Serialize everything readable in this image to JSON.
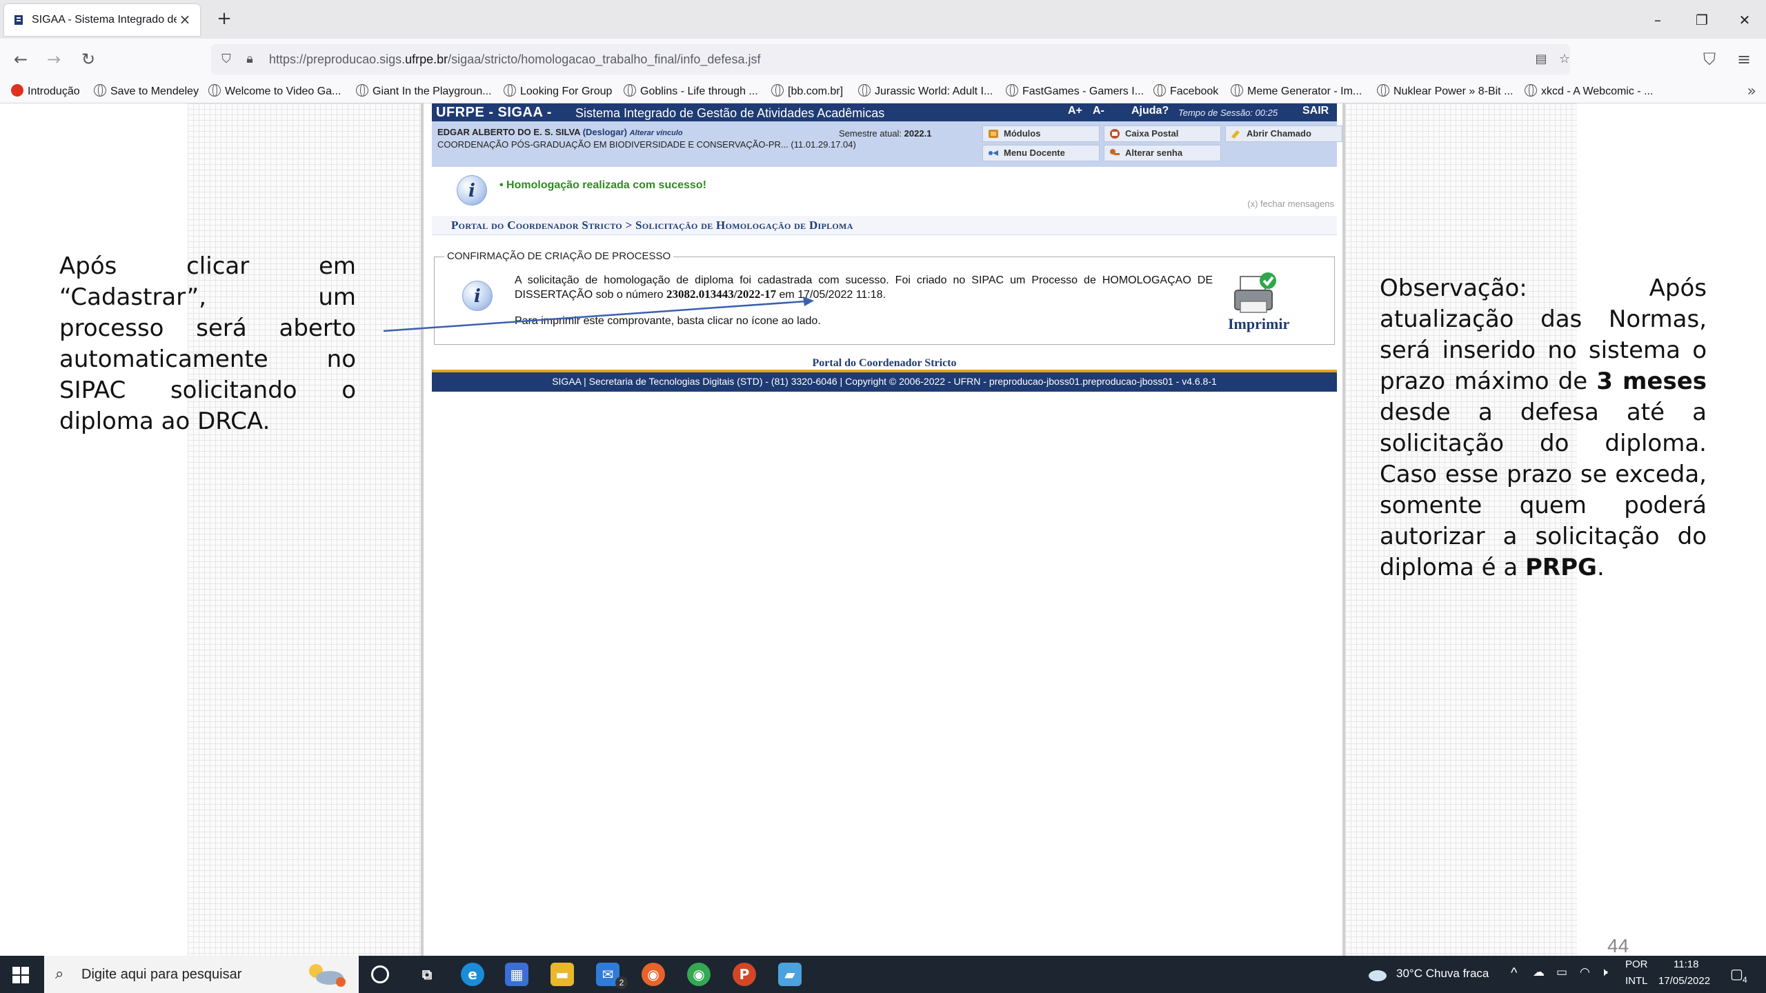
{
  "browser": {
    "tab_title": "SIGAA - Sistema Integrado de G",
    "url_prefix": "https://preproducao.sigs.",
    "url_domain": "ufrpe.br",
    "url_path": "/sigaa/stricto/homologacao_trabalho_final/info_defesa.jsf",
    "bookmarks": [
      "Introdução",
      "Save to Mendeley",
      "Welcome to Video Ga...",
      "Giant In the Playgroun...",
      "Looking For Group",
      "Goblins - Life through ...",
      "[bb.com.br]",
      "Jurassic World: Adult I...",
      "FastGames - Gamers I...",
      "Facebook",
      "Meme Generator - Im...",
      "Nuklear Power » 8-Bit ...",
      "xkcd - A Webcomic - ..."
    ]
  },
  "slide": {
    "left_note": "Após clicar em “Cadastrar”, um processo será aberto automaticamente no SIPAC solicitando o diploma ao DRCA.",
    "right_note_part1": "Observação: Após atualização das Normas, será inserido no sistema o prazo máximo de ",
    "right_note_bold1": "3 meses",
    "right_note_part2": " desde a defesa até a solicitação do diploma. Caso esse prazo se exceda, somente quem poderá autorizar a solicitação do diploma é a ",
    "right_note_bold2": "PRPG",
    "right_note_part3": ".",
    "page_number": "44"
  },
  "sigaa": {
    "brand": "UFRPE - SIGAA -",
    "system_name": "Sistema Integrado de Gestão de Atividades Acadêmicas",
    "font_up": "A+",
    "font_down": "A-",
    "help": "Ajuda?",
    "session_label": "Tempo de Sessão: 00:25",
    "logout": "SAIR",
    "user_name": "EDGAR ALBERTO DO E. S. SILVA",
    "logoff_link": "(Deslogar)",
    "change_link": "Alterar vínculo",
    "coordination": "COORDENAÇÃO PÓS-GRADUAÇÃO EM BIODIVERSIDADE E CONSERVAÇÃO-PR... (11.01.29.17.04)",
    "semester_label": "Semestre atual:",
    "semester_value": "2022.1",
    "menu": {
      "modules": "Módulos",
      "mailbox": "Caixa Postal",
      "ticket": "Abrir Chamado",
      "teacher_menu": "Menu Docente",
      "change_password": "Alterar senha"
    },
    "success_message": "• Homologação realizada com sucesso!",
    "close_messages": "(x) fechar mensagens",
    "breadcrumb": "Portal do Coordenador Stricto > Solicitação de Homologação de Diploma",
    "box_title": "CONFIRMAÇÃO DE CRIAÇÃO DE PROCESSO",
    "box_text_1": "A solicitação de homologação de diploma foi cadastrada com sucesso. Foi criado no SIPAC um Processo de HOMOLOGAÇAO DE DISSERTAÇÃO sob o número ",
    "process_number": "23082.013443/2022-17",
    "box_text_2": " em 17/05/2022 11:18.",
    "print_hint": "Para imprimir este comprovante, basta clicar no ícone ao lado.",
    "print_label": "Imprimir",
    "portal_link": "Portal do Coordenador Stricto",
    "footer": "SIGAA | Secretaria de Tecnologias Digitais (STD) - (81) 3320-6046 | Copyright © 2006-2022 - UFRN - preproducao-jboss01.preproducao-jboss01 - v4.6.8-1"
  },
  "taskbar": {
    "search_placeholder": "Digite aqui para pesquisar",
    "mail_badge": "2",
    "weather": "30°C  Chuva fraca",
    "lang1": "POR",
    "lang2": "INTL",
    "time": "11:18",
    "date": "17/05/2022",
    "notif_count": "4"
  }
}
